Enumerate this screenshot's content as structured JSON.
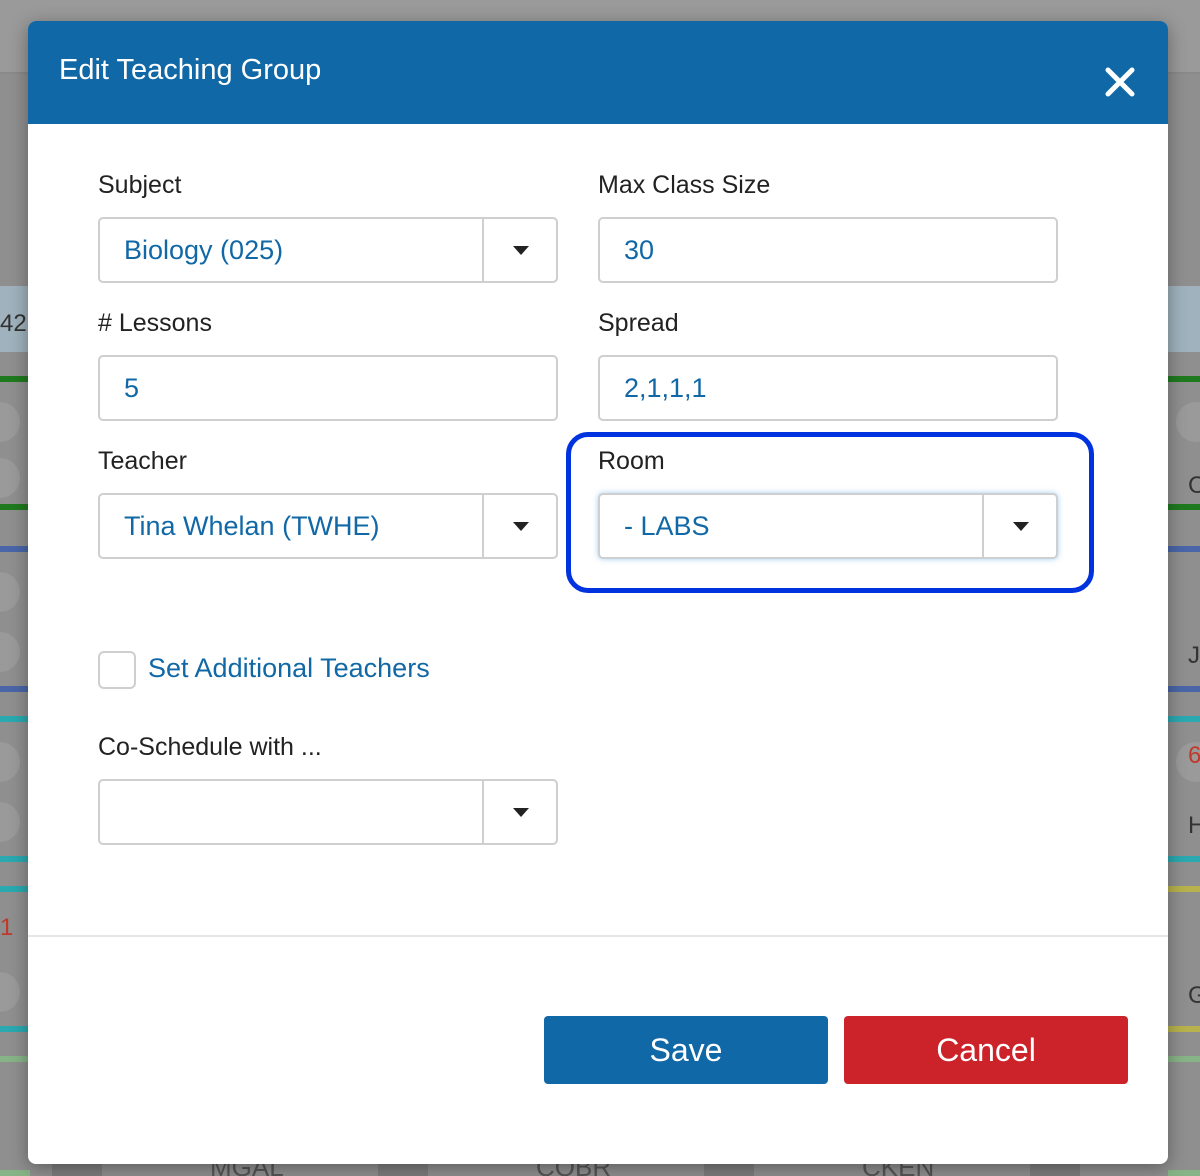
{
  "modal": {
    "title": "Edit Teaching Group",
    "close_icon": "close-icon"
  },
  "form": {
    "subject": {
      "label": "Subject",
      "value": "Biology (025)"
    },
    "max_class_size": {
      "label": "Max Class Size",
      "value": "30"
    },
    "lessons": {
      "label": "# Lessons",
      "value": "5"
    },
    "spread": {
      "label": "Spread",
      "value": "2,1,1,1"
    },
    "teacher": {
      "label": "Teacher",
      "value": "Tina Whelan (TWHE)"
    },
    "room": {
      "label": "Room",
      "value": "- LABS"
    },
    "additional_teachers": {
      "label": "Set Additional Teachers",
      "checked": false
    },
    "co_schedule": {
      "label": "Co-Schedule with ...",
      "value": ""
    }
  },
  "buttons": {
    "save": "Save",
    "cancel": "Cancel"
  },
  "background": {
    "left_fragments": [
      "42",
      "1"
    ],
    "right_fragments": [
      "C",
      "J",
      "6",
      "H",
      "G"
    ],
    "bottom_labels": [
      "MGAL",
      "COBR",
      "CKEN"
    ]
  },
  "colors": {
    "header": "#1168a6",
    "accent_text": "#1168a6",
    "save": "#1168a6",
    "cancel": "#cc2229",
    "highlight": "#0033e0"
  }
}
